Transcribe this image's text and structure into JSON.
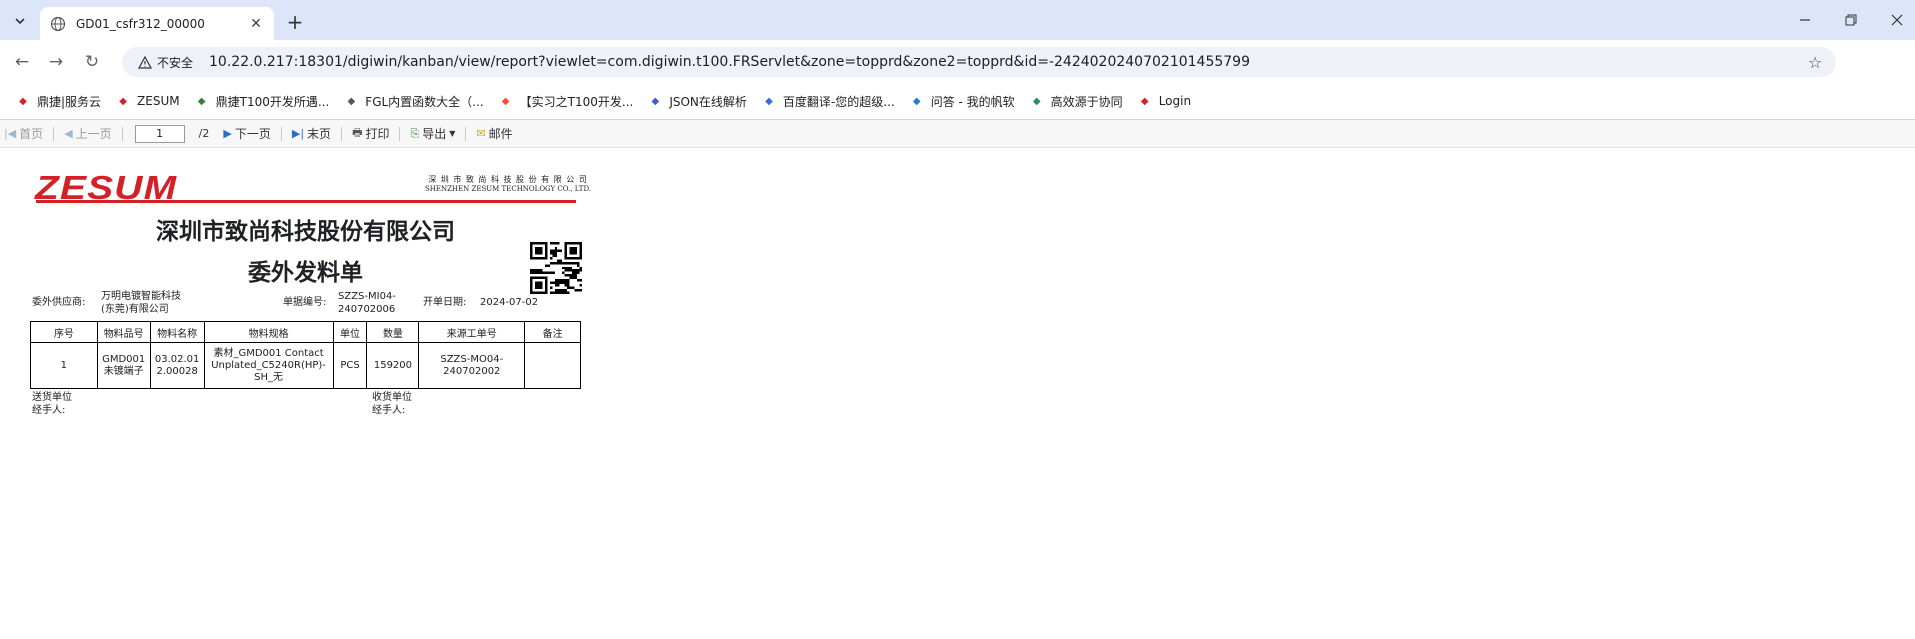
{
  "browser": {
    "tab_title": "GD01_csfr312_00000",
    "security_label": "不安全",
    "url": "10.22.0.217:18301/digiwin/kanban/view/report?viewlet=com.digiwin.t100.FRServlet&zone=topprd&zone2=topprd&id=-2424020240702101455799"
  },
  "bookmarks": [
    {
      "label": "鼎捷|服务云",
      "icon": "dingjie-logo-icon",
      "color": "#d42127"
    },
    {
      "label": "ZESUM",
      "icon": "zesum-logo-icon",
      "color": "#d42127"
    },
    {
      "label": "鼎捷T100开发所遇...",
      "icon": "tool-icon",
      "color": "#3b7d3b"
    },
    {
      "label": "FGL内置函数大全（...",
      "icon": "function-icon",
      "color": "#555555"
    },
    {
      "label": "【实习之T100开发...",
      "icon": "csdn-icon",
      "color": "#f2502a"
    },
    {
      "label": "JSON在线解析",
      "icon": "json-icon",
      "color": "#3a5fcd"
    },
    {
      "label": "百度翻译-您的超级...",
      "icon": "translate-icon",
      "color": "#2e6fe0"
    },
    {
      "label": "问答 - 我的帆软",
      "icon": "fanruan-icon",
      "color": "#1f7ad6"
    },
    {
      "label": "高效源于协同",
      "icon": "gear-icon",
      "color": "#2e8b57"
    },
    {
      "label": "Login",
      "icon": "login-logo-icon",
      "color": "#d42127"
    }
  ],
  "report_toolbar": {
    "first": "首页",
    "prev": "上一页",
    "page_value": "1",
    "page_total": "/2",
    "next": "下一页",
    "last": "末页",
    "print": "打印",
    "export": "导出",
    "mail": "邮件"
  },
  "report": {
    "logo_text": "ZESUM",
    "company_cn_small": "深 圳 市 致 尚 科 技 股 份 有 限 公 司",
    "company_en_small": "SHENZHEN  ZESUM  TECHNOLOGY  CO., LTD.",
    "company_title": "深圳市致尚科技股份有限公司",
    "doc_title": "委外发料单",
    "supplier_label": "委外供应商:",
    "supplier_line1": "万明电镀智能科技",
    "supplier_line2": "(东莞)有限公司",
    "docno_label": "单据编号:",
    "docno_line1": "SZZS-MI04-",
    "docno_line2": "240702006",
    "date_label": "开单日期:",
    "date_value": "2024-07-02",
    "columns": [
      "序号",
      "物料品号",
      "物料名称",
      "物料规格",
      "单位",
      "数量",
      "来源工单号",
      "备注"
    ],
    "row": {
      "seq": "1",
      "item_no_1": "GMD001",
      "item_no_2": "未镀端子",
      "item_name_1": "03.02.01",
      "item_name_2": "2.00028",
      "spec_1": "素材_GMD001 Contact",
      "spec_2": "Unplated_C5240R(HP)-",
      "spec_3": "SH_无",
      "unit": "PCS",
      "qty": "159200",
      "source_1": "SZZS-MO04-",
      "source_2": "240702002",
      "remark": ""
    },
    "deliver_unit": "送货单位",
    "deliver_handler": "经手人:",
    "receive_unit": "收货单位",
    "receive_handler": "经手人:"
  }
}
